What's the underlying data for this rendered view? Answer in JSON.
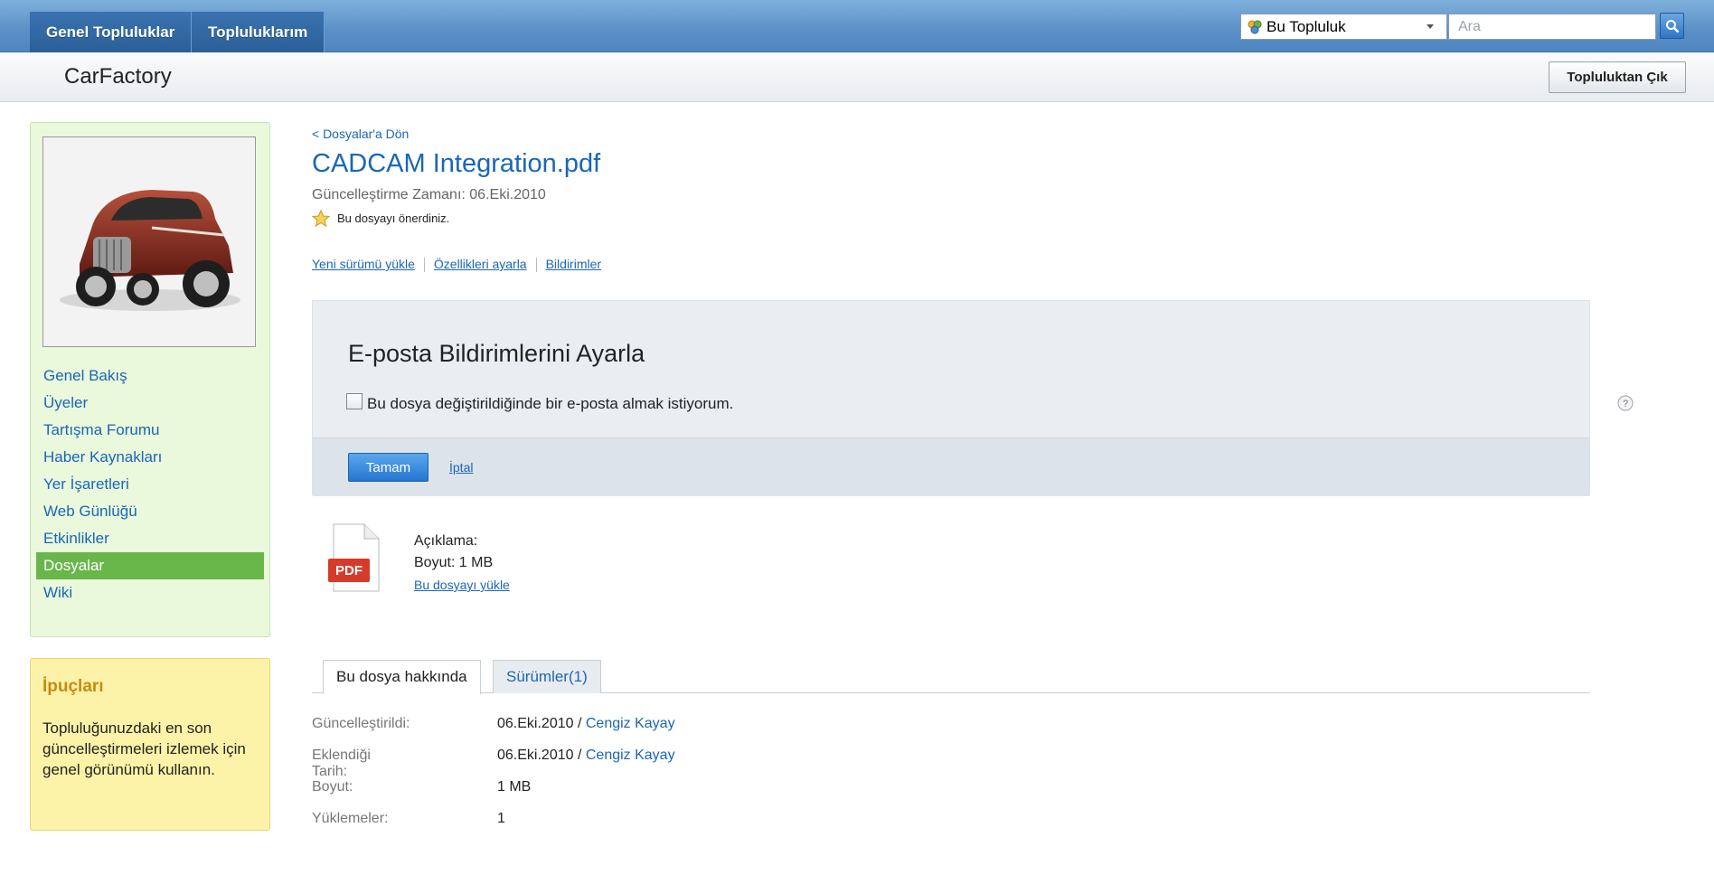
{
  "topbar": {
    "tabs": [
      "Genel Topluluklar",
      "Topluluklarım"
    ],
    "scope": "Bu Topluluk",
    "search_placeholder": "Ara"
  },
  "subheader": {
    "title": "CarFactory",
    "leave_button": "Topluluktan Çık"
  },
  "sidebar": {
    "items": [
      "Genel Bakış",
      "Üyeler",
      "Tartışma Forumu",
      "Haber Kaynakları",
      "Yer İşaretleri",
      "Web Günlüğü",
      "Etkinlikler",
      "Dosyalar",
      "Wiki"
    ],
    "active_index": 7
  },
  "tips": {
    "title": "İpuçları",
    "body": "Topluluğunuzdaki en son güncelleştirmeleri izlemek için genel görünümü kullanın."
  },
  "file": {
    "back_link": "< Dosyalar'a Dön",
    "title": "CADCAM Integration.pdf",
    "updated": "Güncelleştirme Zamanı: 06.Eki.2010",
    "recommended": "Bu dosyayı önerdiniz.",
    "actions": [
      "Yeni sürümü yükle",
      "Özellikleri ayarla",
      "Bildirimler"
    ],
    "description_label": "Açıklama:",
    "size_label": "Boyut: 1 MB",
    "download_link": "Bu dosyayı yükle",
    "icon_label": "PDF"
  },
  "notify": {
    "title": "E-posta Bildirimlerini Ayarla",
    "checkbox_label": "Bu dosya değiştirildiğinde bir e-posta almak istiyorum.",
    "checked": false,
    "ok_button": "Tamam",
    "cancel_link": "İptal"
  },
  "tabs": {
    "about": "Bu dosya hakkında",
    "versions": "Sürümler(1)"
  },
  "properties": {
    "updated_label": "Güncelleştirildi:",
    "updated_date": "06.Eki.2010",
    "updated_by": "Cengiz Kayay",
    "added_label": "Eklendiği Tarih:",
    "added_date": "06.Eki.2010",
    "added_by": "Cengiz Kayay",
    "size_label": "Boyut:",
    "size_value": "1 MB",
    "downloads_label": "Yüklemeler:",
    "downloads_value": "1",
    "separator": " / "
  },
  "colors": {
    "topbar": "#5b90c6",
    "link": "#1a66b7",
    "nav_active": "#69b64b",
    "nav_bg": "#eaf8dc",
    "tips_bg": "#fdf3a8"
  }
}
